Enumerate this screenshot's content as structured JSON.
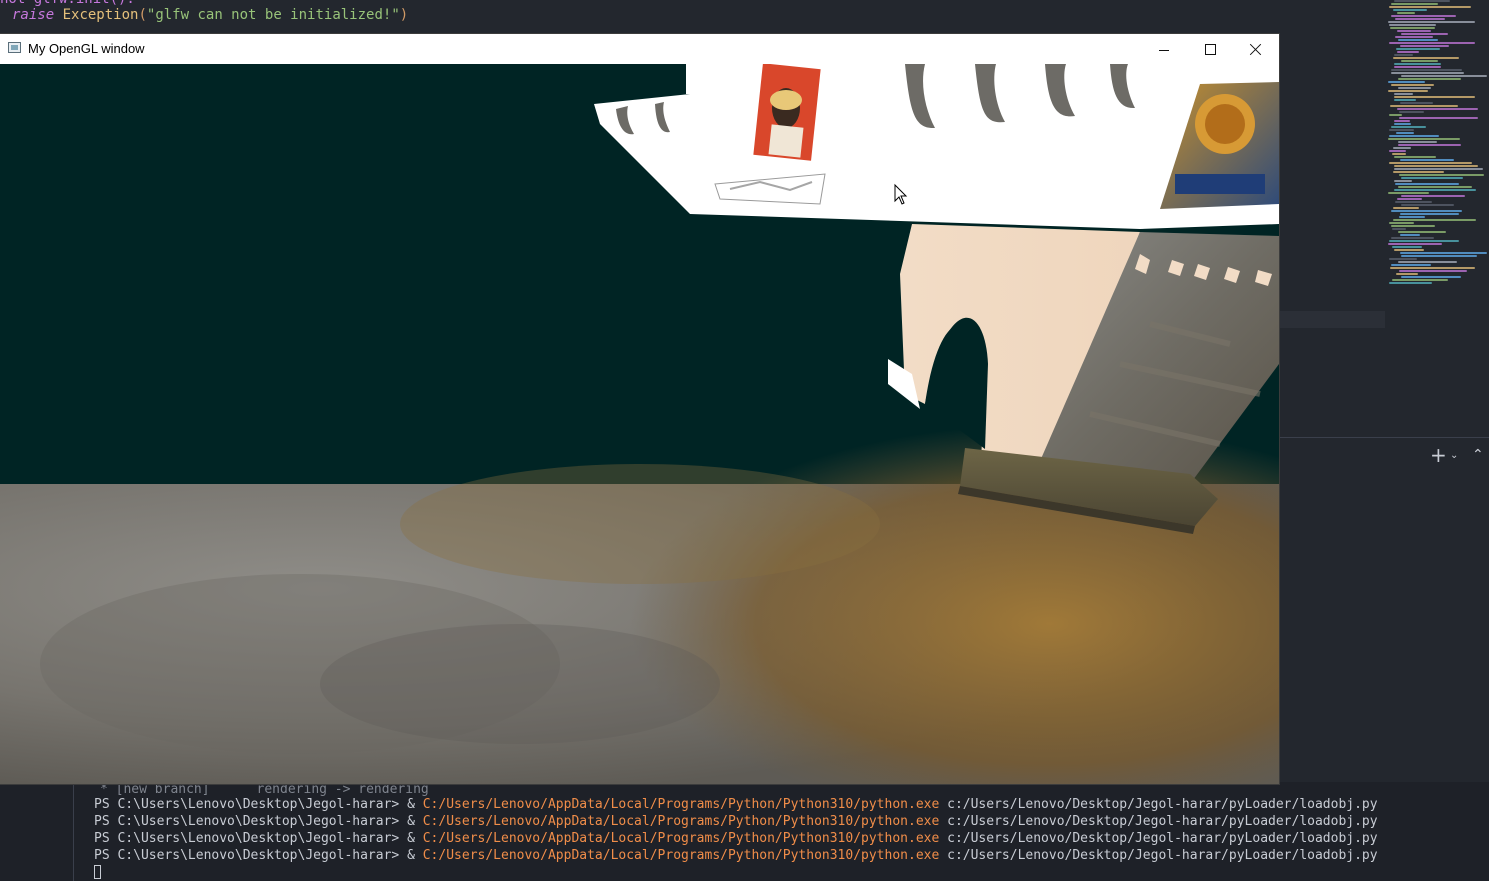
{
  "editor": {
    "code_line_0": "not glfw.init():",
    "code_keyword": "raise",
    "code_exception": "Exception",
    "code_string": "\"glfw can not be initialized!\""
  },
  "terminal": {
    "partial_line": "* [new branch]      rendering -> rendering",
    "prompt": "PS C:\\Users\\Lenovo\\Desktop\\Jegol-harar> & ",
    "exe_path": "C:/Users/Lenovo/AppData/Local/Programs/Python/Python310/python.exe",
    "script_path": " c:/Users/Lenovo/Desktop/Jegol-harar/pyLoader/loadobj.py"
  },
  "gl_window": {
    "title": "My OpenGL window",
    "sky_color": "#002424"
  },
  "icons": {
    "app": "opengl-app-icon",
    "minimize": "minimize-icon",
    "maximize": "maximize-icon",
    "close": "close-icon",
    "new_terminal": "plus-icon",
    "dropdown": "chevron-down-icon",
    "maximize_panel": "chevron-up-icon"
  }
}
